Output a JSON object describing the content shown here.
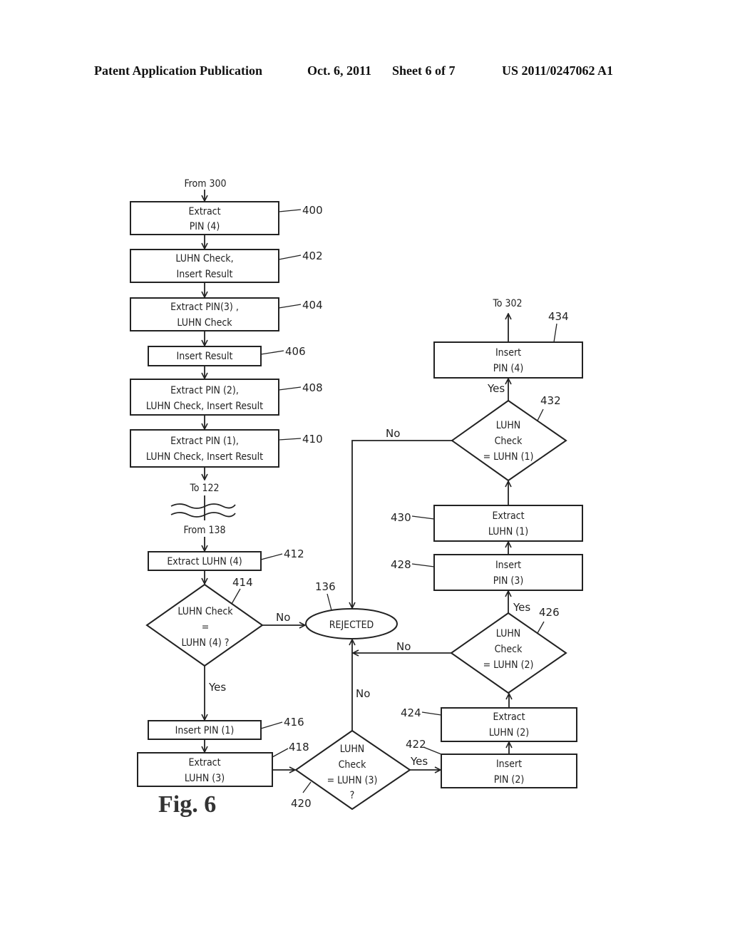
{
  "header": {
    "publication": "Patent Application Publication",
    "date": "Oct. 6, 2011",
    "sheet": "Sheet 6 of 7",
    "number": "US 2011/0247062 A1"
  },
  "figure_label": "Fig. 6",
  "connectors": {
    "from_300": "From 300",
    "to_122": "To 122",
    "from_138": "From 138",
    "to_302": "To 302"
  },
  "steps": {
    "s400": {
      "ref": "400",
      "lines": [
        "Extract",
        "PIN (4)"
      ]
    },
    "s402": {
      "ref": "402",
      "lines": [
        "LUHN Check,",
        "Insert Result"
      ]
    },
    "s404": {
      "ref": "404",
      "lines": [
        "Extract PIN(3) ,",
        "LUHN Check"
      ]
    },
    "s406": {
      "ref": "406",
      "lines": [
        "Insert Result"
      ]
    },
    "s408": {
      "ref": "408",
      "lines": [
        "Extract PIN (2),",
        "LUHN Check, Insert Result"
      ]
    },
    "s410": {
      "ref": "410",
      "lines": [
        "Extract PIN (1),",
        "LUHN Check, Insert Result"
      ]
    },
    "s412": {
      "ref": "412",
      "lines": [
        "Extract LUHN (4)"
      ]
    },
    "s414": {
      "ref": "414",
      "lines": [
        "LUHN Check",
        "=",
        "LUHN (4) ?"
      ]
    },
    "s416": {
      "ref": "416",
      "lines": [
        "Insert PIN (1)"
      ]
    },
    "s418": {
      "ref": "418",
      "lines": [
        "Extract",
        "LUHN (3)"
      ]
    },
    "s420": {
      "ref": "420",
      "lines": [
        "LUHN",
        "Check",
        "= LUHN (3)",
        "?"
      ]
    },
    "s422": {
      "ref": "422",
      "lines": [
        "Insert",
        "PIN (2)"
      ]
    },
    "s424": {
      "ref": "424",
      "lines": [
        "Extract",
        "LUHN (2)"
      ]
    },
    "s426": {
      "ref": "426",
      "lines": [
        "LUHN",
        "Check",
        "= LUHN (2)"
      ]
    },
    "s428": {
      "ref": "428",
      "lines": [
        "Insert",
        "PIN (3)"
      ]
    },
    "s430": {
      "ref": "430",
      "lines": [
        "Extract",
        "LUHN (1)"
      ]
    },
    "s432": {
      "ref": "432",
      "lines": [
        "LUHN",
        "Check",
        "= LUHN (1)"
      ]
    },
    "s434": {
      "ref": "434",
      "lines": [
        "Insert",
        "PIN (4)"
      ]
    },
    "s136": {
      "ref": "136",
      "lines": [
        "REJECTED"
      ]
    }
  },
  "edge_labels": {
    "yes": "Yes",
    "no": "No"
  }
}
